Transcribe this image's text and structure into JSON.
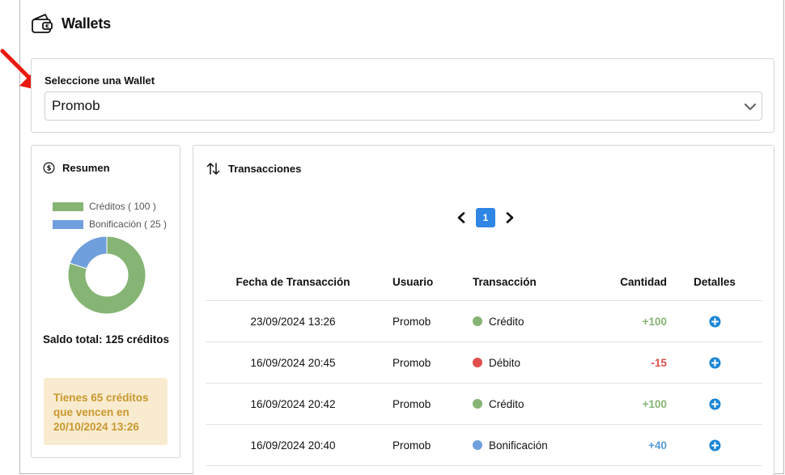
{
  "header": {
    "title": "Wallets",
    "icon": "wallet-icon"
  },
  "wallet_selector": {
    "label": "Seleccione una Wallet",
    "selected": "Promob"
  },
  "summary": {
    "title": "Resumen",
    "legend": [
      {
        "label": "Créditos ( 100 )",
        "color": "#86b474"
      },
      {
        "label": "Bonificación ( 25 )",
        "color": "#6f9fdc"
      }
    ],
    "chart_data": {
      "type": "pie",
      "categories": [
        "Créditos",
        "Bonificación"
      ],
      "values": [
        100,
        25
      ],
      "colors": [
        "#86b474",
        "#6f9fdc"
      ]
    },
    "saldo_total": "Saldo total: 125 créditos",
    "expiry_notice": "Tienes 65 créditos que vencen en 20/10/2024 13:26"
  },
  "transactions": {
    "title": "Transacciones",
    "pagination": {
      "current_page": "1"
    },
    "columns": {
      "fecha": "Fecha de Transacción",
      "usuario": "Usuario",
      "transaccion": "Transacción",
      "cantidad": "Cantidad",
      "detalles": "Detalles"
    },
    "rows": [
      {
        "fecha": "23/09/2024 13:26",
        "usuario": "Promob",
        "tipo": "Crédito",
        "cantidad": "+100",
        "dot_color": "#86b474",
        "amount_color": "#86b474"
      },
      {
        "fecha": "16/09/2024 20:45",
        "usuario": "Promob",
        "tipo": "Débito",
        "cantidad": "-15",
        "dot_color": "#e04e4e",
        "amount_color": "#e04e4e"
      },
      {
        "fecha": "16/09/2024 20:42",
        "usuario": "Promob",
        "tipo": "Crédito",
        "cantidad": "+100",
        "dot_color": "#86b474",
        "amount_color": "#86b474"
      },
      {
        "fecha": "16/09/2024 20:40",
        "usuario": "Promob",
        "tipo": "Bonificación",
        "cantidad": "+40",
        "dot_color": "#6f9fdc",
        "amount_color": "#5b9bd5"
      }
    ]
  },
  "colors": {
    "accent": "#2f86e4",
    "detail_icon": "#1b86d6",
    "expiry_bg": "#f8ebcf",
    "expiry_text": "#c9982e"
  }
}
